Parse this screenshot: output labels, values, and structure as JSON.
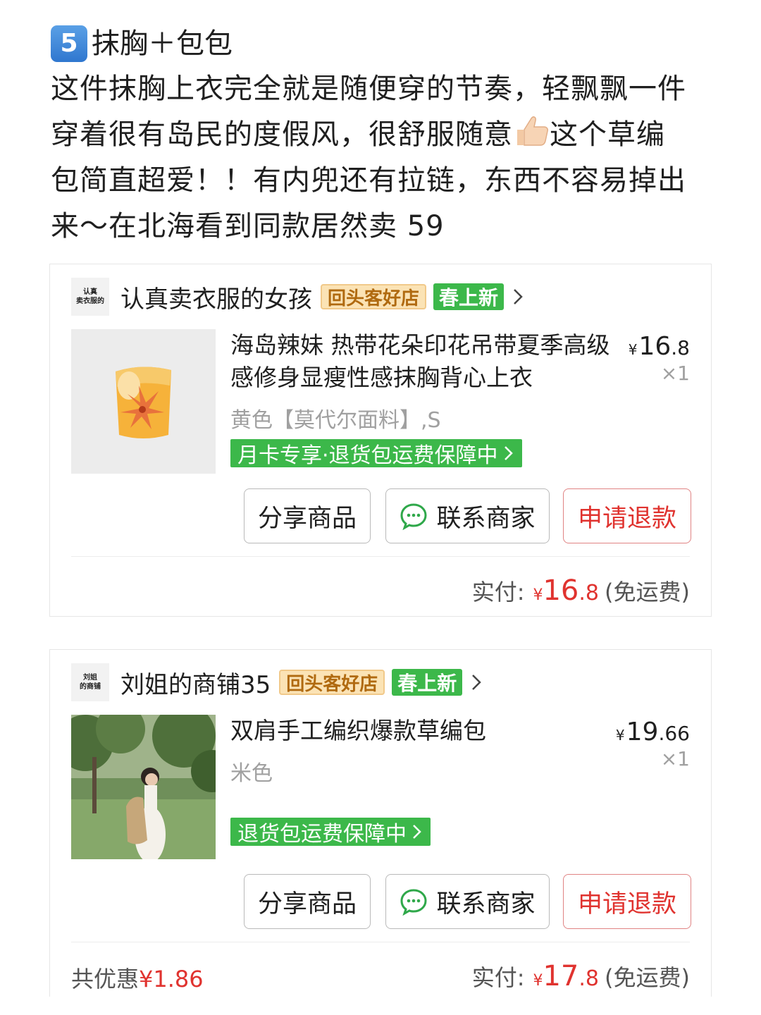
{
  "post": {
    "number": "5",
    "title": "抹胸＋包包",
    "body_line1": "这件抹胸上衣完全就是随便穿的节奏，轻飘飘一件",
    "body_line2_a": "穿着很有岛民的度假风，很舒服随意",
    "body_line2_b": "这个草编",
    "body_line3": "包简直超爱！！有内兜还有拉链，东西不容易掉出",
    "body_line4": "来～在北海看到同款居然卖 59"
  },
  "orders": [
    {
      "shop_logo_line1": "认真",
      "shop_logo_line2": "卖衣服的",
      "shop_name": "认真卖衣服的女孩",
      "tag_return": "回头客好店",
      "tag_new": "春上新",
      "product_title": "海岛辣妹 热带花朵印花吊带夏季高级感修身显瘦性感抹胸背心上衣",
      "spec": "黄色【莫代尔面料】,S",
      "price_yen": "¥",
      "price_int": "16",
      "price_dec": ".8",
      "qty": "×1",
      "guarantee": "月卡专享·退货包运费保障中",
      "btn_share": "分享商品",
      "btn_contact": "联系商家",
      "btn_refund": "申请退款",
      "paid_label": "实付:",
      "paid_yen": "¥",
      "paid_int": "16",
      "paid_dec": ".8",
      "paid_note": "(免运费)"
    },
    {
      "shop_logo_line1": "刘姐",
      "shop_logo_line2": "的商铺",
      "shop_name": "刘姐的商铺35",
      "tag_return": "回头客好店",
      "tag_new": "春上新",
      "product_title": "双肩手工编织爆款草编包",
      "spec": "米色",
      "price_yen": "¥",
      "price_int": "19",
      "price_dec": ".66",
      "qty": "×1",
      "guarantee": "退货包运费保障中",
      "btn_share": "分享商品",
      "btn_contact": "联系商家",
      "btn_refund": "申请退款",
      "discount_label": "共优惠",
      "discount_value": "¥1.86",
      "paid_label": "实付:",
      "paid_yen": "¥",
      "paid_int": "17",
      "paid_dec": ".8",
      "paid_note": "(免运费)"
    }
  ],
  "colors": {
    "accent_green": "#3cb84a",
    "refund_red": "#e0332f",
    "tag_orange": "#b06a10"
  }
}
